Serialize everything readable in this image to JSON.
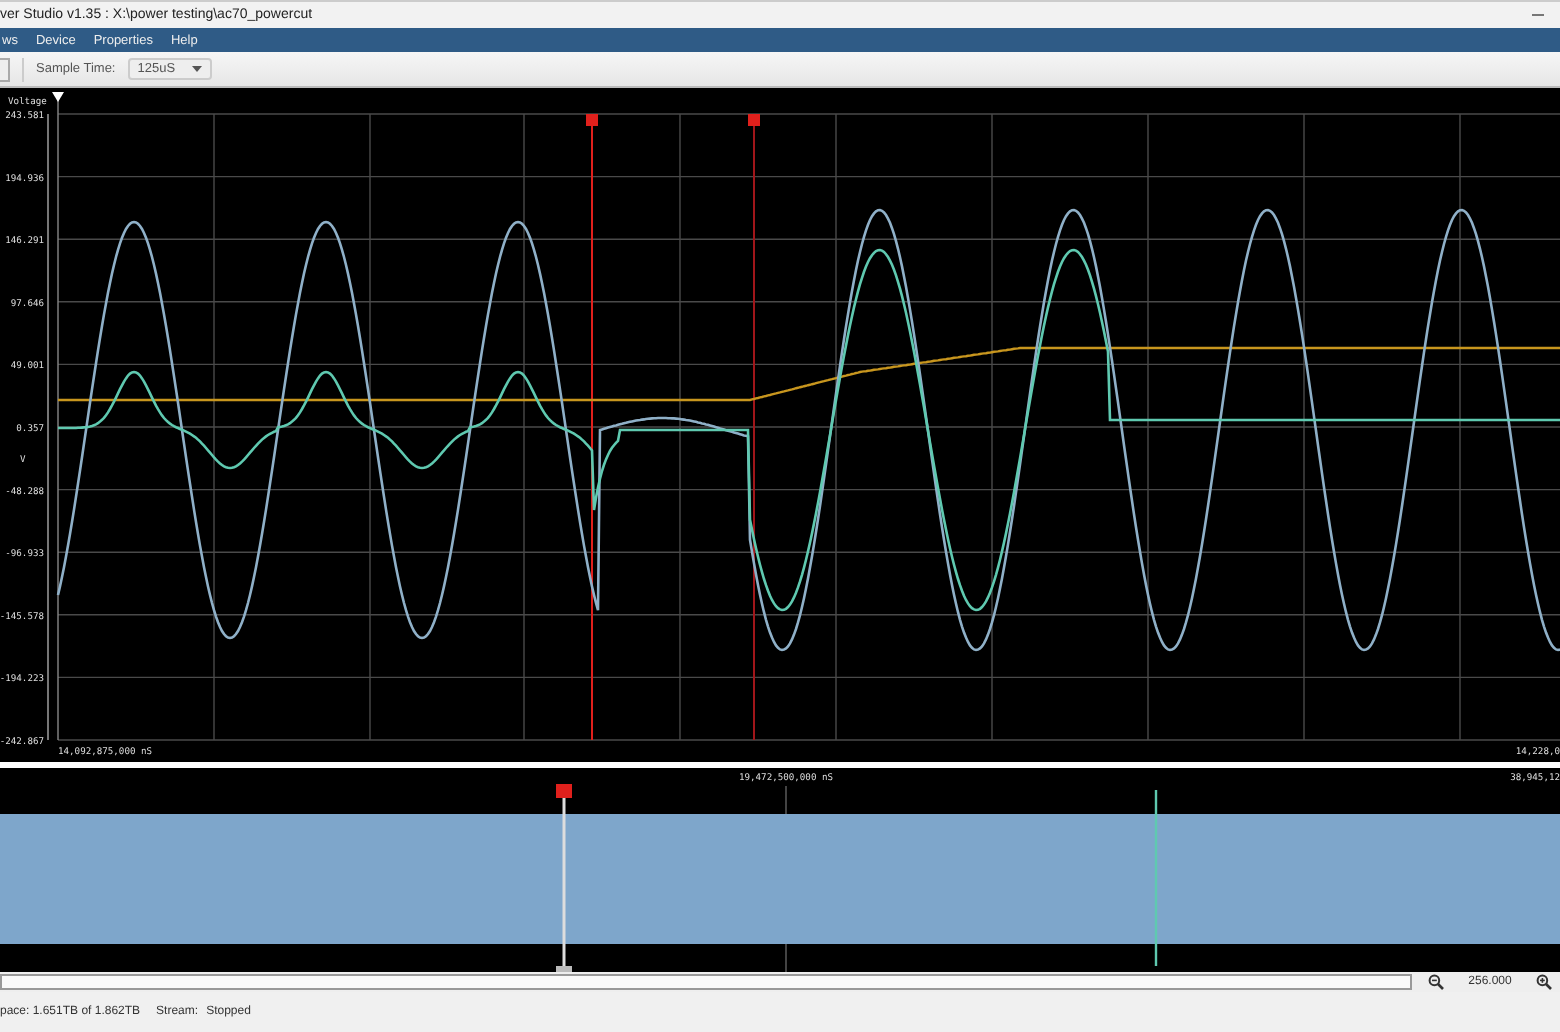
{
  "window": {
    "title": "ver Studio v1.35 : X:\\power testing\\ac70_powercut"
  },
  "menu": [
    "ws",
    "Device",
    "Properties",
    "Help"
  ],
  "toolbar": {
    "sample_time_label": "Sample Time:",
    "sample_time_value": "125uS"
  },
  "plot": {
    "y_title": "Voltage",
    "y_unit": "V",
    "y_ticks": [
      "243.581",
      "194.936",
      "146.291",
      "97.646",
      "49.001",
      "0.357",
      "-48.288",
      "-96.933",
      "-145.578",
      "-194.223",
      "-242.867"
    ],
    "x_start": "14,092,875,000 nS",
    "x_end": "14,228,0"
  },
  "overview": {
    "center_label": "19,472,500,000 nS",
    "end_label": "38,945,12"
  },
  "zoom": {
    "value": "256.000"
  },
  "status_bar": {
    "space": "pace: 1.651TB of 1.862TB",
    "stream_label": "Stream:",
    "stream_value": "Stopped"
  }
}
